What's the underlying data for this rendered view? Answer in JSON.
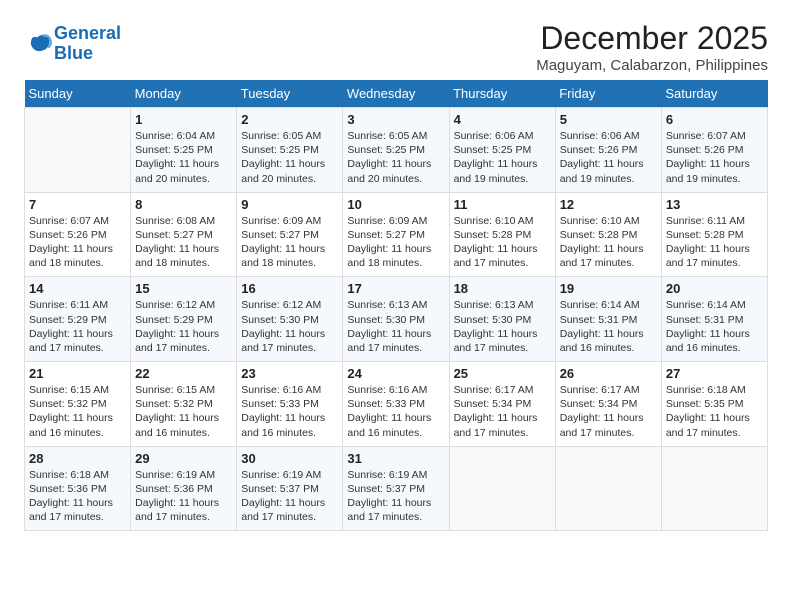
{
  "logo": {
    "line1": "General",
    "line2": "Blue"
  },
  "title": "December 2025",
  "subtitle": "Maguyam, Calabarzon, Philippines",
  "header": {
    "days": [
      "Sunday",
      "Monday",
      "Tuesday",
      "Wednesday",
      "Thursday",
      "Friday",
      "Saturday"
    ]
  },
  "weeks": [
    [
      {
        "num": "",
        "sunrise": "",
        "sunset": "",
        "daylight": ""
      },
      {
        "num": "1",
        "sunrise": "Sunrise: 6:04 AM",
        "sunset": "Sunset: 5:25 PM",
        "daylight": "Daylight: 11 hours and 20 minutes."
      },
      {
        "num": "2",
        "sunrise": "Sunrise: 6:05 AM",
        "sunset": "Sunset: 5:25 PM",
        "daylight": "Daylight: 11 hours and 20 minutes."
      },
      {
        "num": "3",
        "sunrise": "Sunrise: 6:05 AM",
        "sunset": "Sunset: 5:25 PM",
        "daylight": "Daylight: 11 hours and 20 minutes."
      },
      {
        "num": "4",
        "sunrise": "Sunrise: 6:06 AM",
        "sunset": "Sunset: 5:25 PM",
        "daylight": "Daylight: 11 hours and 19 minutes."
      },
      {
        "num": "5",
        "sunrise": "Sunrise: 6:06 AM",
        "sunset": "Sunset: 5:26 PM",
        "daylight": "Daylight: 11 hours and 19 minutes."
      },
      {
        "num": "6",
        "sunrise": "Sunrise: 6:07 AM",
        "sunset": "Sunset: 5:26 PM",
        "daylight": "Daylight: 11 hours and 19 minutes."
      }
    ],
    [
      {
        "num": "7",
        "sunrise": "Sunrise: 6:07 AM",
        "sunset": "Sunset: 5:26 PM",
        "daylight": "Daylight: 11 hours and 18 minutes."
      },
      {
        "num": "8",
        "sunrise": "Sunrise: 6:08 AM",
        "sunset": "Sunset: 5:27 PM",
        "daylight": "Daylight: 11 hours and 18 minutes."
      },
      {
        "num": "9",
        "sunrise": "Sunrise: 6:09 AM",
        "sunset": "Sunset: 5:27 PM",
        "daylight": "Daylight: 11 hours and 18 minutes."
      },
      {
        "num": "10",
        "sunrise": "Sunrise: 6:09 AM",
        "sunset": "Sunset: 5:27 PM",
        "daylight": "Daylight: 11 hours and 18 minutes."
      },
      {
        "num": "11",
        "sunrise": "Sunrise: 6:10 AM",
        "sunset": "Sunset: 5:28 PM",
        "daylight": "Daylight: 11 hours and 17 minutes."
      },
      {
        "num": "12",
        "sunrise": "Sunrise: 6:10 AM",
        "sunset": "Sunset: 5:28 PM",
        "daylight": "Daylight: 11 hours and 17 minutes."
      },
      {
        "num": "13",
        "sunrise": "Sunrise: 6:11 AM",
        "sunset": "Sunset: 5:28 PM",
        "daylight": "Daylight: 11 hours and 17 minutes."
      }
    ],
    [
      {
        "num": "14",
        "sunrise": "Sunrise: 6:11 AM",
        "sunset": "Sunset: 5:29 PM",
        "daylight": "Daylight: 11 hours and 17 minutes."
      },
      {
        "num": "15",
        "sunrise": "Sunrise: 6:12 AM",
        "sunset": "Sunset: 5:29 PM",
        "daylight": "Daylight: 11 hours and 17 minutes."
      },
      {
        "num": "16",
        "sunrise": "Sunrise: 6:12 AM",
        "sunset": "Sunset: 5:30 PM",
        "daylight": "Daylight: 11 hours and 17 minutes."
      },
      {
        "num": "17",
        "sunrise": "Sunrise: 6:13 AM",
        "sunset": "Sunset: 5:30 PM",
        "daylight": "Daylight: 11 hours and 17 minutes."
      },
      {
        "num": "18",
        "sunrise": "Sunrise: 6:13 AM",
        "sunset": "Sunset: 5:30 PM",
        "daylight": "Daylight: 11 hours and 17 minutes."
      },
      {
        "num": "19",
        "sunrise": "Sunrise: 6:14 AM",
        "sunset": "Sunset: 5:31 PM",
        "daylight": "Daylight: 11 hours and 16 minutes."
      },
      {
        "num": "20",
        "sunrise": "Sunrise: 6:14 AM",
        "sunset": "Sunset: 5:31 PM",
        "daylight": "Daylight: 11 hours and 16 minutes."
      }
    ],
    [
      {
        "num": "21",
        "sunrise": "Sunrise: 6:15 AM",
        "sunset": "Sunset: 5:32 PM",
        "daylight": "Daylight: 11 hours and 16 minutes."
      },
      {
        "num": "22",
        "sunrise": "Sunrise: 6:15 AM",
        "sunset": "Sunset: 5:32 PM",
        "daylight": "Daylight: 11 hours and 16 minutes."
      },
      {
        "num": "23",
        "sunrise": "Sunrise: 6:16 AM",
        "sunset": "Sunset: 5:33 PM",
        "daylight": "Daylight: 11 hours and 16 minutes."
      },
      {
        "num": "24",
        "sunrise": "Sunrise: 6:16 AM",
        "sunset": "Sunset: 5:33 PM",
        "daylight": "Daylight: 11 hours and 16 minutes."
      },
      {
        "num": "25",
        "sunrise": "Sunrise: 6:17 AM",
        "sunset": "Sunset: 5:34 PM",
        "daylight": "Daylight: 11 hours and 17 minutes."
      },
      {
        "num": "26",
        "sunrise": "Sunrise: 6:17 AM",
        "sunset": "Sunset: 5:34 PM",
        "daylight": "Daylight: 11 hours and 17 minutes."
      },
      {
        "num": "27",
        "sunrise": "Sunrise: 6:18 AM",
        "sunset": "Sunset: 5:35 PM",
        "daylight": "Daylight: 11 hours and 17 minutes."
      }
    ],
    [
      {
        "num": "28",
        "sunrise": "Sunrise: 6:18 AM",
        "sunset": "Sunset: 5:36 PM",
        "daylight": "Daylight: 11 hours and 17 minutes."
      },
      {
        "num": "29",
        "sunrise": "Sunrise: 6:19 AM",
        "sunset": "Sunset: 5:36 PM",
        "daylight": "Daylight: 11 hours and 17 minutes."
      },
      {
        "num": "30",
        "sunrise": "Sunrise: 6:19 AM",
        "sunset": "Sunset: 5:37 PM",
        "daylight": "Daylight: 11 hours and 17 minutes."
      },
      {
        "num": "31",
        "sunrise": "Sunrise: 6:19 AM",
        "sunset": "Sunset: 5:37 PM",
        "daylight": "Daylight: 11 hours and 17 minutes."
      },
      {
        "num": "",
        "sunrise": "",
        "sunset": "",
        "daylight": ""
      },
      {
        "num": "",
        "sunrise": "",
        "sunset": "",
        "daylight": ""
      },
      {
        "num": "",
        "sunrise": "",
        "sunset": "",
        "daylight": ""
      }
    ]
  ]
}
